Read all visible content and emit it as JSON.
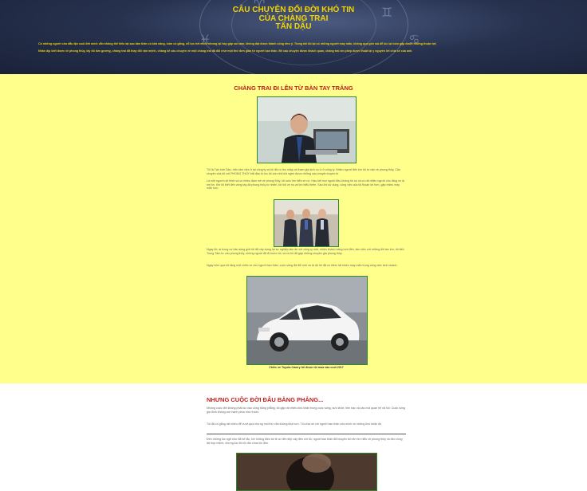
{
  "hero": {
    "title_lines": [
      "CÂU CHUYỆN ĐỔI ĐỜI KHÓ TIN",
      "CỦA CHÀNG TRAI",
      "TẤN DẬU"
    ],
    "intro_1": "Có những người cho dẫu tận cuối đời mình vẫn không thể hiểu tại sao bản thân có khả năng, luôn cố gắng, nỗ lực hết mình nhưng lại hay gặp sai sầm, không đạt được thành công như ý. Trong khi đó lại có những người may mắn, không quá giỏi mà dễ lúc lại luôn gặp được những thuận lợi.",
    "intro_2": "Nhân dịp biết được về phong thủy, lấy đó làm gương, chàng trai đã thay đổi vận mệnh, chàng kể câu chuyện về một chàng trai đã đổi nhờ một thứ đơn giản từ người bạn thân. Để câu chuyện được khách quan, chàng trai xin phép được thuật lại y nguyên lời chia sẻ của anh."
  },
  "section1": {
    "title": "CHÀNG TRAI ĐI LÊN TỪ BÀN TAY TRẮNG",
    "para1": "Tôi là Tấn mới Dậu, hiện làm việc ở tại công ty và tôi đã có thu nhập và tham gia dịch vụ vì ở công ty. Nhiều người đến tìm tôi tư vấn về phong thủy. Câu chuyện của tôi với PHONG THỦY bắt đầu từ lúc tôi còn nhỏ khi nghe được những câu chuyện huyền bí.",
    "para2": "Là một người rất thích và có nhiều đam mê về phong thủy, tôi luôn tìm hiểu về nó. Hầu hết mọi người đều không tin nó và có rất nhiều người cho rằng nó là mê tín. Khi tôi biết đến vòng tay đá phong thủy tự nhiên, tôi hỏi về nó và tìm hiểu thêm. Sau khi sử dụng, công việc của tôi thuận lợi hơn, gặp nhiều may mắn hơn.",
    "para3": "Ngay đó, ai trong cơ bản sống giới tôi đã xây dựng lại sự nghiệp làm ăn với công ty mới, nhiều khách hàng mới đến, làm việc với những đối tác lớn, tôi đến Trung Tâm tư vấn phong thủy, những người đã đi trước tôi, và rồi tôi đã gặp những chuyên gia phong thủy.",
    "para4": "Ngày hôm qua tôi tặng một chiếc xe cho người bạn thân, cuộc sống đã đổi mới và từ đó tôi đã có thêm rất nhiều may mắn trong công việc kinh doanh.",
    "caption": "Chiếc xe Toyota Camry tôi được tôi mua vào cuối 2017"
  },
  "section2": {
    "title": "NHƯNG CUỘC ĐỜI ĐÂU BẰNG PHẲNG...",
    "para1": "Nhưng cuộc đời không phải lúc nào cũng bằng phẳng, tôi gặp rất nhiều khó khăn trong cuộc sống, sức khỏe, tiền bạc và các mối quan hệ xã hội. Cuộc sống gia đình không còn hạnh phúc như trước.",
    "para2": "Tôi đã cố gắng rất nhiều để vượt qua nhưng mọi thứ vẫn không khá hơn. Tôi chia sẻ với người bạn thân của mình về những khó khăn đó.",
    "para3": "Đến những lúc ngỡ như đã bế tắc, khi những điều tồi tệ cứ liên tiếp xảy đến với tôi, người bạn thân đã khuyên tôi nên tìm hiểu về phong thủy và đeo vòng đá hợp mệnh, nhưng lúc đó tôi vẫn chưa tin lắm."
  },
  "colors": {
    "hero_bg": "#1a2238",
    "accent_yellow": "#f5d400",
    "section_bg": "#ffff8c",
    "title_red": "#c0201e"
  }
}
